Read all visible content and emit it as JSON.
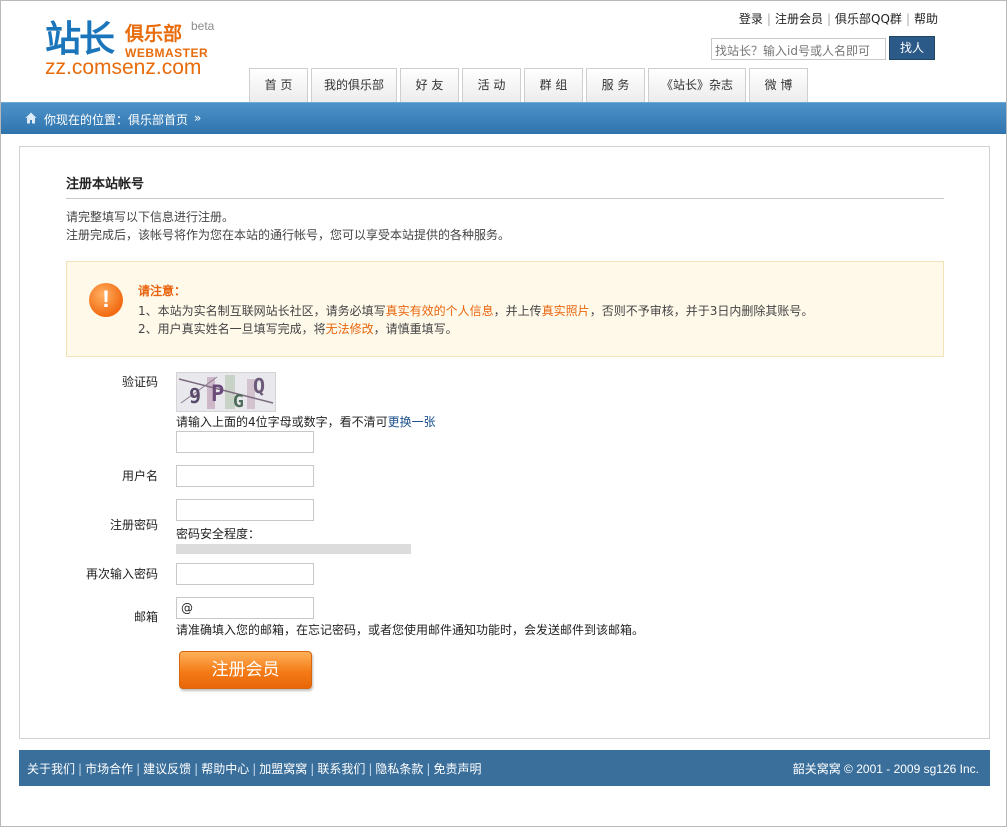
{
  "logo": {
    "chinese": "站长",
    "club": "俱乐部",
    "beta": "beta",
    "webmaster": "WEBMASTER",
    "domain": "zz.comsenz.com"
  },
  "toplinks": [
    "登录",
    "注册会员",
    "俱乐部QQ群",
    "帮助"
  ],
  "search": {
    "placeholder": "找站长？输入id号或人名即可",
    "button": "找人"
  },
  "nav": [
    "首 页",
    "我的俱乐部",
    "好 友",
    "活 动",
    "群 组",
    "服 务",
    "《站长》杂志",
    "微 博"
  ],
  "location": {
    "text": "你现在的位置：俱乐部首页",
    "raquo": "»"
  },
  "main": {
    "title": "注册本站帐号",
    "intro1": "请完整填写以下信息进行注册。",
    "intro2": "注册完成后，该帐号将作为您在本站的通行帐号，您可以享受本站提供的各种服务。"
  },
  "notice": {
    "icon": "!",
    "title": "请注意：",
    "line1_a": "1、本站为实名制互联网站长社区，请务必填写",
    "line1_hl1": "真实有效的个人信息",
    "line1_b": "，并上传",
    "line1_hl2": "真实照片",
    "line1_c": "，否则不予审核，并于3日内删除其账号。",
    "line2_a": "2、用户真实姓名一旦填写完成，将",
    "line2_hl": "无法修改",
    "line2_b": "，请慎重填写。"
  },
  "form": {
    "captcha_label": "验证码",
    "captcha_hint": "请输入上面的4位字母或数字，看不清可",
    "captcha_refresh": "更换一张",
    "username_label": "用户名",
    "password_label": "注册密码",
    "password_strength": "密码安全程度：",
    "password2_label": "再次输入密码",
    "email_label": "邮箱",
    "email_value": "@",
    "email_hint": "请准确填入您的邮箱，在忘记密码，或者您使用邮件通知功能时，会发送邮件到该邮箱。",
    "submit": "注册会员"
  },
  "footer": {
    "links": [
      "关于我们",
      "市场合作",
      "建议反馈",
      "帮助中心",
      "加盟窝窝",
      "联系我们",
      "隐私条款",
      "免责声明"
    ],
    "copyright": "韶关窝窝  © 2001 - 2009 sg126 Inc."
  }
}
